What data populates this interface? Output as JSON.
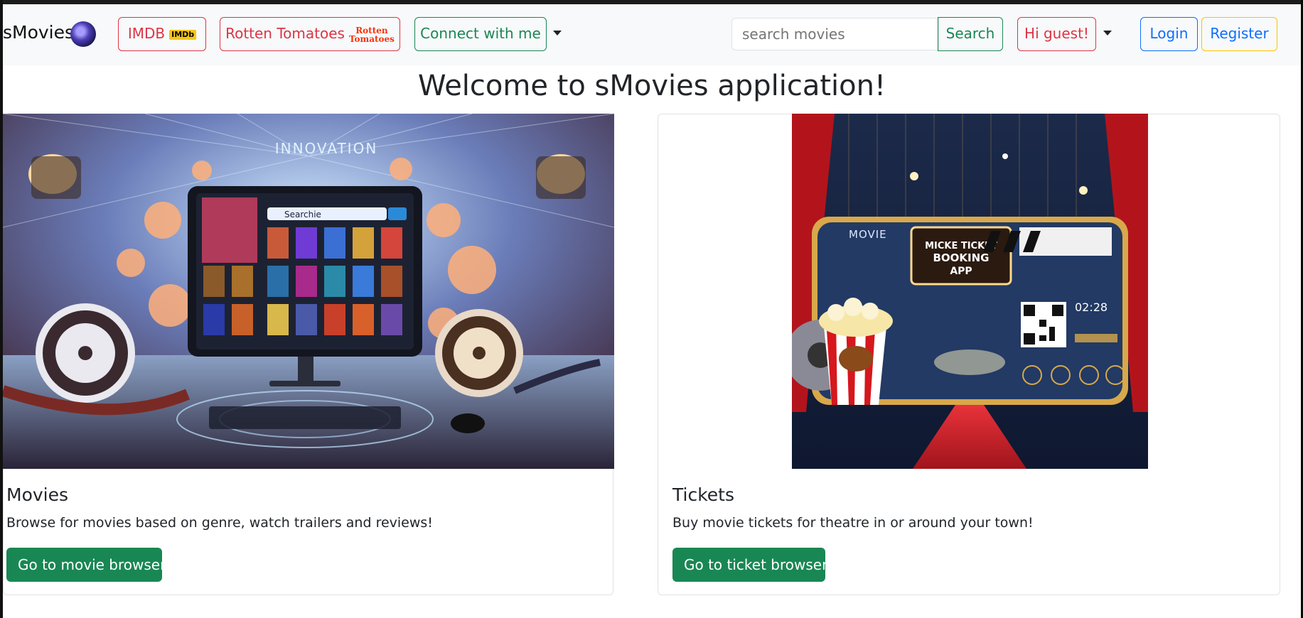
{
  "navbar": {
    "brand": "sMovies",
    "imdb_label": "IMDB",
    "imdb_badge": "IMDb",
    "rt_label": "Rotten Tomatoes",
    "rt_badge_line1": "Rotten",
    "rt_badge_line2": "Tomatoes",
    "connect_label": "Connect with me",
    "search_placeholder": "search movies",
    "search_button": "Search",
    "greeting": "Hi guest!",
    "login": "Login",
    "register": "Register"
  },
  "page": {
    "title": "Welcome to sMovies application!"
  },
  "cards": [
    {
      "title": "Movies",
      "text": "Browse for movies based on genre, watch trailers and reviews!",
      "button": "Go to movie browser",
      "image_heading": "INNOVATION",
      "image_search": "Searchie"
    },
    {
      "title": "Tickets",
      "text": "Buy movie tickets for theatre in or around your town!",
      "button": "Go to ticket browser",
      "image_brand": "MOVIE",
      "image_sign_1": "MICKE TICKET",
      "image_sign_2": "BOOKING",
      "image_sign_3": "APP",
      "image_time": "02:28"
    }
  ],
  "colors": {
    "success": "#198754",
    "danger": "#dc3545",
    "primary": "#0d6efd",
    "warning": "#ffc107"
  }
}
